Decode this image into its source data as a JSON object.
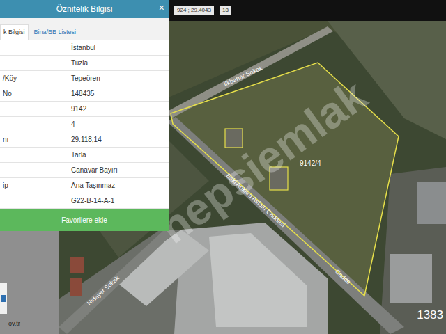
{
  "panel": {
    "title": "Öznitelik Bilgisi",
    "close": "×",
    "tabs": [
      {
        "label": "k Bilgisi",
        "selected": true
      },
      {
        "label": "Bina/BB Listesi",
        "selected": false
      }
    ],
    "rows": [
      {
        "label": "",
        "value": "İstanbul"
      },
      {
        "label": "",
        "value": "Tuzla"
      },
      {
        "label": "/Köy",
        "value": "Tepeören"
      },
      {
        "label": "No",
        "value": "148435"
      },
      {
        "label": "",
        "value": "9142"
      },
      {
        "label": "",
        "value": "4"
      },
      {
        "label": "nı",
        "value": "29.118,14"
      },
      {
        "label": "",
        "value": "Tarla"
      },
      {
        "label": "",
        "value": "Canavar Bayırı"
      },
      {
        "label": "ip",
        "value": "Ana Taşınmaz"
      },
      {
        "label": "",
        "value": "G22-B-14-A-1"
      }
    ],
    "button": "Favorilere ekle"
  },
  "footer": {
    "text": "ov.tr"
  },
  "topbar": {
    "coordinates": "924 ; 29.4043",
    "zoom": "18"
  },
  "map": {
    "parcel_label": "9142/4",
    "streets": [
      "İlkbahar Sokak",
      "Eski Ankara Asfaltı Caddesi",
      "Cadde",
      "Hidayet Sokak"
    ],
    "watermark": "hepsiemlak",
    "scale": "1383"
  }
}
